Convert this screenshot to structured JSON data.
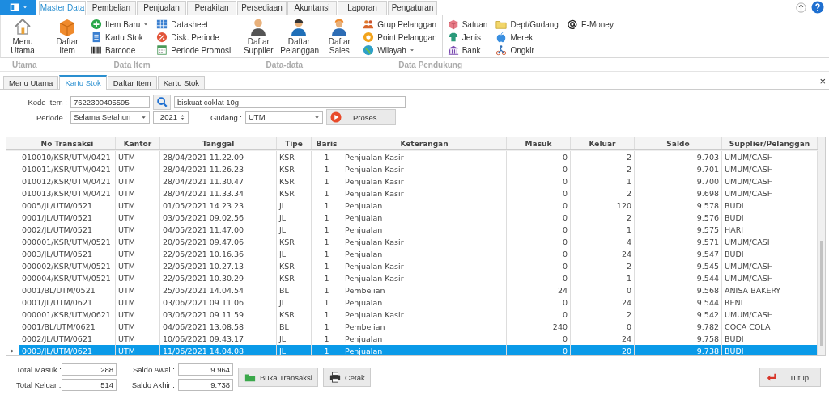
{
  "ribbon": {
    "tabs": [
      {
        "label": "Master Data",
        "selected": true
      },
      {
        "label": "Pembelian",
        "selected": false
      },
      {
        "label": "Penjualan",
        "selected": false
      },
      {
        "label": "Perakitan",
        "selected": false
      },
      {
        "label": "Persediaan",
        "selected": false
      },
      {
        "label": "Akuntansi",
        "selected": false
      },
      {
        "label": "Laporan",
        "selected": false
      },
      {
        "label": "Pengaturan",
        "selected": false
      }
    ],
    "groups": [
      {
        "label": "Utama",
        "items": [
          {
            "label": "Menu Utama",
            "kind": "large"
          }
        ]
      },
      {
        "label": "Data Item",
        "items": [
          {
            "label": "Daftar Item",
            "kind": "large"
          },
          {
            "label": "Item Baru",
            "kind": "small",
            "dropdown": true
          },
          {
            "label": "Kartu Stok",
            "kind": "small"
          },
          {
            "label": "Barcode",
            "kind": "small"
          },
          {
            "label": "Datasheet",
            "kind": "small"
          },
          {
            "label": "Disk. Periode",
            "kind": "small"
          },
          {
            "label": "Periode Promosi",
            "kind": "small"
          }
        ]
      },
      {
        "label": "Data-data",
        "items": [
          {
            "label": "Daftar Supplier",
            "kind": "large"
          },
          {
            "label": "Daftar Pelanggan",
            "kind": "large"
          },
          {
            "label": "Daftar Sales",
            "kind": "large"
          },
          {
            "label": "Grup Pelanggan",
            "kind": "small"
          },
          {
            "label": "Point Pelanggan",
            "kind": "small"
          },
          {
            "label": "Wilayah",
            "kind": "small",
            "dropdown": true
          }
        ]
      },
      {
        "label": "Data Pendukung",
        "items": [
          {
            "label": "Satuan",
            "kind": "small"
          },
          {
            "label": "Jenis",
            "kind": "small"
          },
          {
            "label": "Bank",
            "kind": "small"
          },
          {
            "label": "Dept/Gudang",
            "kind": "small"
          },
          {
            "label": "Merek",
            "kind": "small"
          },
          {
            "label": "Ongkir",
            "kind": "small"
          },
          {
            "label": "E-Money",
            "kind": "small"
          }
        ]
      }
    ]
  },
  "document_tabs": [
    {
      "label": "Menu Utama",
      "selected": false
    },
    {
      "label": "Kartu Stok",
      "selected": true
    },
    {
      "label": "Daftar Item",
      "selected": false
    },
    {
      "label": "Kartu Stok",
      "selected": false
    }
  ],
  "close_glyph": "×",
  "form": {
    "kode_item": {
      "label": "Kode Item :",
      "value": "7622300405595",
      "name": "biskuat coklat 10g"
    },
    "periode": {
      "label": "Periode :",
      "value": "Selama Setahun"
    },
    "year": "2021",
    "gudang": {
      "label": "Gudang :",
      "value": "UTM"
    },
    "proses_button": "Proses"
  },
  "table": {
    "columns": [
      "No Transaksi",
      "Kantor",
      "Tanggal",
      "Tipe",
      "Baris",
      "Keterangan",
      "Masuk",
      "Keluar",
      "Saldo",
      "Supplier/Pelanggan"
    ],
    "rows": [
      {
        "cells": [
          "010010/KSR/UTM/0421",
          "UTM",
          "28/04/2021 11.22.09",
          "KSR",
          "1",
          "Penjualan Kasir",
          "0",
          "2",
          "9.703",
          "UMUM/CASH"
        ],
        "selected": false
      },
      {
        "cells": [
          "010011/KSR/UTM/0421",
          "UTM",
          "28/04/2021 11.26.23",
          "KSR",
          "1",
          "Penjualan Kasir",
          "0",
          "2",
          "9.701",
          "UMUM/CASH"
        ],
        "selected": false
      },
      {
        "cells": [
          "010012/KSR/UTM/0421",
          "UTM",
          "28/04/2021 11.30.47",
          "KSR",
          "1",
          "Penjualan Kasir",
          "0",
          "1",
          "9.700",
          "UMUM/CASH"
        ],
        "selected": false
      },
      {
        "cells": [
          "010013/KSR/UTM/0421",
          "UTM",
          "28/04/2021 11.33.34",
          "KSR",
          "1",
          "Penjualan Kasir",
          "0",
          "2",
          "9.698",
          "UMUM/CASH"
        ],
        "selected": false
      },
      {
        "cells": [
          "0005/JL/UTM/0521",
          "UTM",
          "01/05/2021 14.23.23",
          "JL",
          "1",
          "Penjualan",
          "0",
          "120",
          "9.578",
          "BUDI"
        ],
        "selected": false
      },
      {
        "cells": [
          "0001/JL/UTM/0521",
          "UTM",
          "03/05/2021 09.02.56",
          "JL",
          "1",
          "Penjualan",
          "0",
          "2",
          "9.576",
          "BUDI"
        ],
        "selected": false
      },
      {
        "cells": [
          "0002/JL/UTM/0521",
          "UTM",
          "04/05/2021 11.47.00",
          "JL",
          "1",
          "Penjualan",
          "0",
          "1",
          "9.575",
          "HARI"
        ],
        "selected": false
      },
      {
        "cells": [
          "000001/KSR/UTM/0521",
          "UTM",
          "20/05/2021 09.47.06",
          "KSR",
          "1",
          "Penjualan Kasir",
          "0",
          "4",
          "9.571",
          "UMUM/CASH"
        ],
        "selected": false
      },
      {
        "cells": [
          "0003/JL/UTM/0521",
          "UTM",
          "22/05/2021 10.16.36",
          "JL",
          "1",
          "Penjualan",
          "0",
          "24",
          "9.547",
          "BUDI"
        ],
        "selected": false
      },
      {
        "cells": [
          "000002/KSR/UTM/0521",
          "UTM",
          "22/05/2021 10.27.13",
          "KSR",
          "1",
          "Penjualan Kasir",
          "0",
          "2",
          "9.545",
          "UMUM/CASH"
        ],
        "selected": false
      },
      {
        "cells": [
          "000004/KSR/UTM/0521",
          "UTM",
          "22/05/2021 10.30.29",
          "KSR",
          "1",
          "Penjualan Kasir",
          "0",
          "1",
          "9.544",
          "UMUM/CASH"
        ],
        "selected": false
      },
      {
        "cells": [
          "0001/BL/UTM/0521",
          "UTM",
          "25/05/2021 14.04.54",
          "BL",
          "1",
          "Pembelian",
          "24",
          "0",
          "9.568",
          "ANISA BAKERY"
        ],
        "selected": false
      },
      {
        "cells": [
          "0001/JL/UTM/0621",
          "UTM",
          "03/06/2021 09.11.06",
          "JL",
          "1",
          "Penjualan",
          "0",
          "24",
          "9.544",
          "RENI"
        ],
        "selected": false
      },
      {
        "cells": [
          "000001/KSR/UTM/0621",
          "UTM",
          "03/06/2021 09.11.59",
          "KSR",
          "1",
          "Penjualan Kasir",
          "0",
          "2",
          "9.542",
          "UMUM/CASH"
        ],
        "selected": false
      },
      {
        "cells": [
          "0001/BL/UTM/0621",
          "UTM",
          "04/06/2021 13.08.58",
          "BL",
          "1",
          "Pembelian",
          "240",
          "0",
          "9.782",
          "COCA COLA"
        ],
        "selected": false
      },
      {
        "cells": [
          "0002/JL/UTM/0621",
          "UTM",
          "10/06/2021 09.43.17",
          "JL",
          "1",
          "Penjualan",
          "0",
          "24",
          "9.758",
          "BUDI"
        ],
        "selected": false
      },
      {
        "cells": [
          "0003/JL/UTM/0621",
          "UTM",
          "11/06/2021 14.04.08",
          "JL",
          "1",
          "Penjualan",
          "0",
          "20",
          "9.738",
          "BUDI"
        ],
        "selected": true
      }
    ]
  },
  "footer": {
    "totals": [
      {
        "label": "Total Masuk :",
        "value": "288"
      },
      {
        "label": "Total Keluar :",
        "value": "514"
      }
    ],
    "saldo": [
      {
        "label": "Saldo Awal :",
        "value": "9.964"
      },
      {
        "label": "Saldo Akhir :",
        "value": "9.738"
      }
    ],
    "buttons": [
      {
        "label": "Buka Transaksi",
        "kind": "open"
      },
      {
        "label": "Cetak",
        "kind": "print"
      }
    ],
    "close_button": "Tutup"
  }
}
